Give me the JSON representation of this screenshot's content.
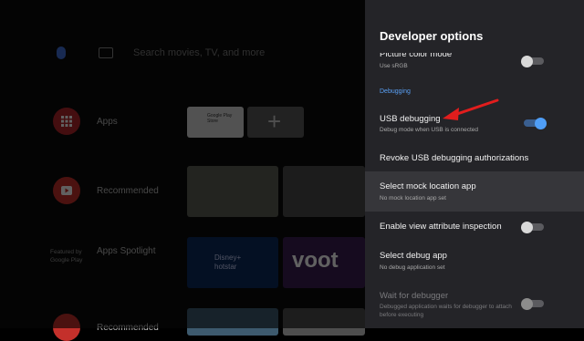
{
  "home": {
    "search_placeholder": "Search movies, TV, and more",
    "rows": [
      {
        "label": "Apps"
      },
      {
        "label": "Recommended"
      },
      {
        "label": "Apps Spotlight"
      },
      {
        "label": "Recommended"
      }
    ],
    "featured_by": "Featured by",
    "google_play": "Google Play",
    "tile_labels": {
      "google_play_store": "Google Play Store",
      "disney_hotstar": "Disney+ hotstar",
      "voot": "voot"
    }
  },
  "panel": {
    "title": "Developer options",
    "items": [
      {
        "title": "Picture color mode",
        "summary": "Use sRGB",
        "switch": "off"
      },
      {
        "title": "USB debugging",
        "summary": "Debug mode when USB is connected",
        "switch": "on"
      },
      {
        "title": "Revoke USB debugging authorizations"
      },
      {
        "title": "Select mock location app",
        "summary": "No mock location app set",
        "focused": true
      },
      {
        "title": "Enable view attribute inspection",
        "switch": "off"
      },
      {
        "title": "Select debug app",
        "summary": "No debug application set"
      },
      {
        "title": "Wait for debugger",
        "summary": "Debugged application waits for debugger to attach before executing",
        "switch": "off",
        "enabled": false
      }
    ],
    "section_debugging": "Debugging"
  },
  "colors": {
    "accent": "#4f9ef7",
    "annotation_arrow": "#e11d1d",
    "panel_bg": "#242428"
  }
}
